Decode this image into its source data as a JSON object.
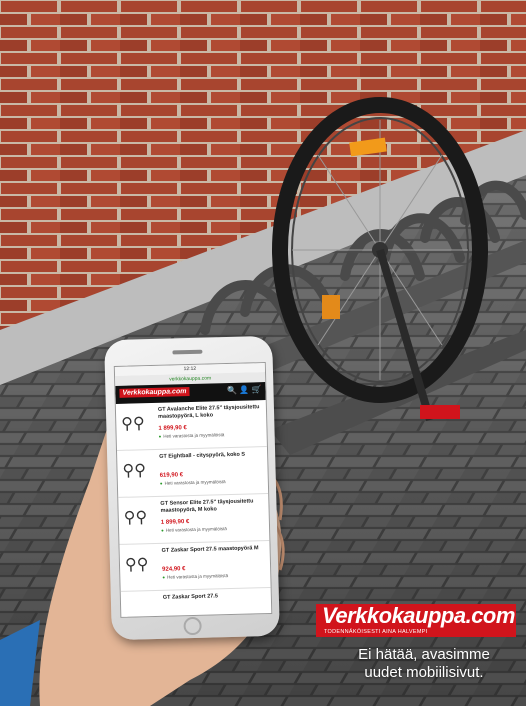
{
  "phone": {
    "status_text": "12:12",
    "url_text": "verkkokauppa.com",
    "app_logo": "Verkkokauppa.com",
    "app_icons": "🔍 👤 🛒",
    "products": [
      {
        "title": "GT Avalanche Elite 27.5\" täysjousitettu maastopyörä, L koko",
        "price": "1 899,90 €",
        "availability": "Heti varastosta ja myymälöistä"
      },
      {
        "title": "GT Eightball - cityspyörä, koko S",
        "price": "619,90 €",
        "availability": "Heti varastosta ja myymälöistä"
      },
      {
        "title": "GT Sensor Elite 27.5\" täysjousitettu maastopyörä, M koko",
        "price": "1 899,90 €",
        "availability": "Heti varastosta ja myymälöistä"
      },
      {
        "title": "GT Zaskar Sport 27.5 maastopyörä M",
        "price": "924,90 €",
        "availability": "Heti varastosta ja myymälöistä"
      },
      {
        "title": "GT Zaskar Sport 27.5",
        "price": "",
        "availability": ""
      }
    ]
  },
  "brand": {
    "logo_text": "Verkkokauppa.com",
    "tagline": "TODENNÄKÖISESTI AINA HALVEMPI"
  },
  "slogan_line1": "Ei hätää, avasimme",
  "slogan_line2": "uudet mobiilisivut.",
  "colors": {
    "brand_red": "#d1141c",
    "brick": "#a8452f",
    "mortar": "#c9b8a6",
    "pavement": "#7d7d7d"
  }
}
